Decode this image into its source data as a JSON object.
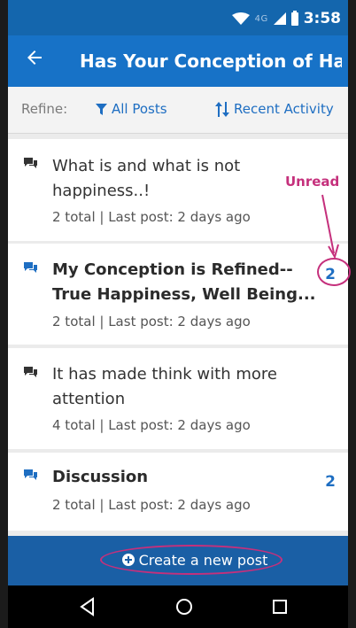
{
  "status": {
    "network": "4G",
    "time": "3:58"
  },
  "appbar": {
    "title": "Has Your Conception of Ha...",
    "back_icon": "arrow-back-icon"
  },
  "refine": {
    "label": "Refine:",
    "filter_label": "All Posts",
    "sort_label": "Recent Activity"
  },
  "posts": [
    {
      "title_line1": "What is and what is not",
      "title_line2": "happiness..!",
      "meta": "2 total | Last post: 2 days ago",
      "unread_count": "",
      "bold": false
    },
    {
      "title_line1": "My Conception is Refined--",
      "title_line2": "True Happiness, Well Being...",
      "meta": "2 total | Last post: 2 days ago",
      "unread_count": "2",
      "bold": true
    },
    {
      "title_line1": "It has made think with more",
      "title_line2": "attention",
      "meta": "4 total | Last post: 2 days ago",
      "unread_count": "",
      "bold": false
    },
    {
      "title_line1": "Discussion",
      "title_line2": "",
      "meta": "2 total | Last post: 2 days ago",
      "unread_count": "2",
      "bold": true
    }
  ],
  "annotation": {
    "unread_label": "Unread"
  },
  "bottom": {
    "create_label": "Create a new post"
  },
  "colors": {
    "primary": "#1772c7",
    "status_bar": "#1466ad",
    "link": "#1e6ec2",
    "annotation": "#c5307c"
  }
}
